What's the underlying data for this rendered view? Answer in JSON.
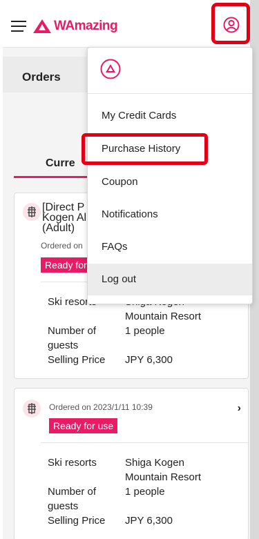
{
  "header": {
    "brand": "WAmazing",
    "brand_color": "#e81b64",
    "menu_icon": "hamburger-icon",
    "user_icon": "user-icon"
  },
  "page": {
    "title": "Orders",
    "tab_label": "Curre"
  },
  "orders": [
    {
      "name_lines": [
        "[Direct P",
        "Kogen Al",
        "(Adult)"
      ],
      "ordered_on": "Ordered on",
      "status": "Ready for",
      "details": [
        {
          "label": "Ski resorts",
          "value": "Shiga Kogen"
        },
        {
          "label": "",
          "value": "Mountain Resort"
        },
        {
          "label": "Number of",
          "value": "1 people"
        },
        {
          "label": "guests",
          "value": ""
        },
        {
          "label": "Selling Price",
          "value": "JPY 6,300"
        }
      ]
    },
    {
      "ordered_on": "Ordered on 2023/1/11 10:39",
      "status": "Ready for use",
      "details": [
        {
          "label": "Ski resorts",
          "value": "Shiga Kogen"
        },
        {
          "label": "",
          "value": "Mountain Resort"
        },
        {
          "label": "Number of",
          "value": "1 people"
        },
        {
          "label": "guests",
          "value": ""
        },
        {
          "label": "Selling Price",
          "value": "JPY 6,300"
        }
      ]
    }
  ],
  "menu": {
    "items": [
      {
        "label": "My Credit Cards"
      },
      {
        "label": "Purchase History"
      },
      {
        "label": "Coupon"
      },
      {
        "label": "Notifications"
      },
      {
        "label": "FAQs"
      },
      {
        "label": "Log out"
      }
    ]
  },
  "colors": {
    "accent": "#e81b64",
    "highlight": "#e30014"
  }
}
